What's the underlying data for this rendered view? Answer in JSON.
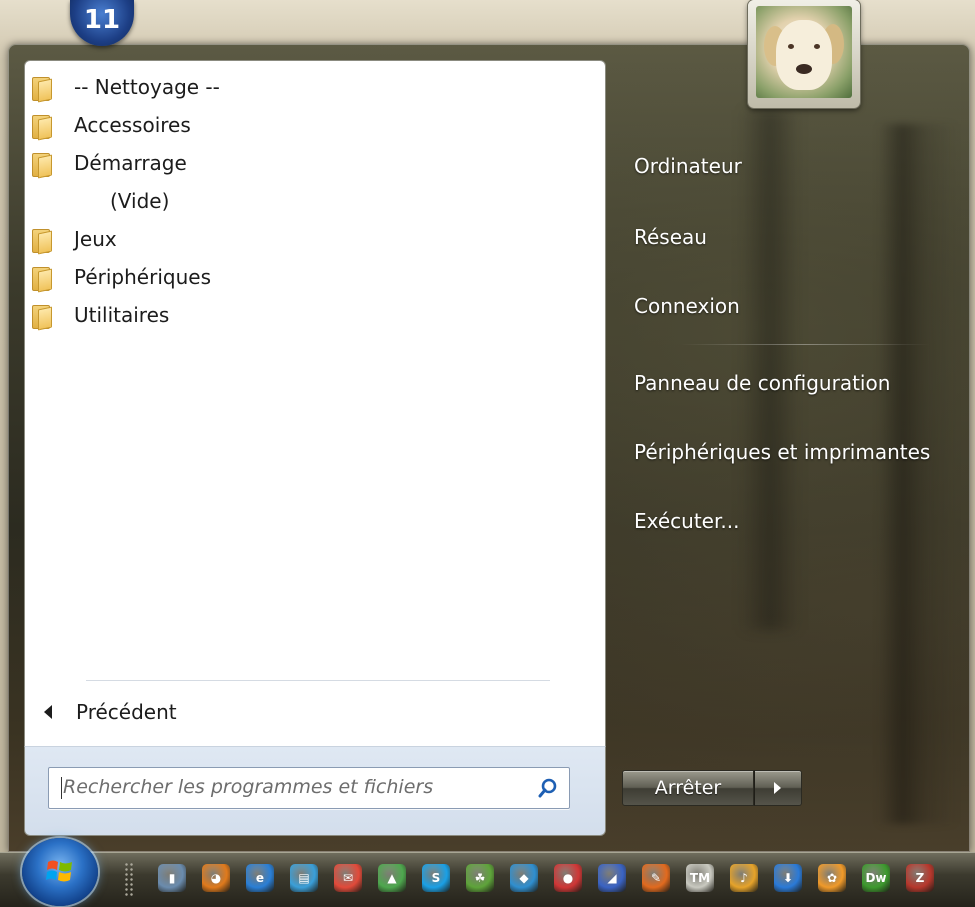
{
  "badge": {
    "text": "11"
  },
  "programs": [
    {
      "label": "-- Nettoyage --",
      "icon": "folder-icon",
      "indent": false
    },
    {
      "label": "Accessoires",
      "icon": "folder-icon",
      "indent": false
    },
    {
      "label": "Démarrage",
      "icon": "folder-icon",
      "indent": false
    },
    {
      "label": "(Vide)",
      "icon": "",
      "indent": true
    },
    {
      "label": "Jeux",
      "icon": "folder-icon",
      "indent": false
    },
    {
      "label": "Périphériques",
      "icon": "folder-icon",
      "indent": false
    },
    {
      "label": "Utilitaires",
      "icon": "folder-icon",
      "indent": false
    }
  ],
  "back_label": "Précédent",
  "search": {
    "placeholder": "Rechercher les programmes et fichiers",
    "value": ""
  },
  "right_links": {
    "computer": "Ordinateur",
    "network": "Réseau",
    "connect": "Connexion",
    "control_panel": "Panneau de configuration",
    "devices_printers": "Périphériques et imprimantes",
    "run": "Exécuter..."
  },
  "shutdown": {
    "label": "Arrêter"
  },
  "taskbar_icons": [
    {
      "name": "usb-drive-icon",
      "color": "#6b8cae"
    },
    {
      "name": "firefox-icon",
      "color": "#e07a1c"
    },
    {
      "name": "internet-explorer-icon",
      "color": "#2a7fd6"
    },
    {
      "name": "printer-icon",
      "color": "#3a9fd9"
    },
    {
      "name": "mail-icon",
      "color": "#e24a3a"
    },
    {
      "name": "photo-gallery-icon",
      "color": "#4ea84e"
    },
    {
      "name": "skype-icon",
      "color": "#1aa0e6"
    },
    {
      "name": "gimp-icon",
      "color": "#5ea43a"
    },
    {
      "name": "virtualbox-icon",
      "color": "#2f8fd0"
    },
    {
      "name": "antivirus-icon",
      "color": "#d03636"
    },
    {
      "name": "app-blue-icon",
      "color": "#3a63c4"
    },
    {
      "name": "paint-icon",
      "color": "#e26a1e"
    },
    {
      "name": "tm-icon",
      "color": "#c9c9c0"
    },
    {
      "name": "winamp-icon",
      "color": "#e6a32a"
    },
    {
      "name": "download-icon",
      "color": "#2a7ad8"
    },
    {
      "name": "palette-icon",
      "color": "#f09a2a"
    },
    {
      "name": "dreamweaver-icon",
      "color": "#3d9a2e"
    },
    {
      "name": "filezilla-icon",
      "color": "#b7372c"
    }
  ]
}
